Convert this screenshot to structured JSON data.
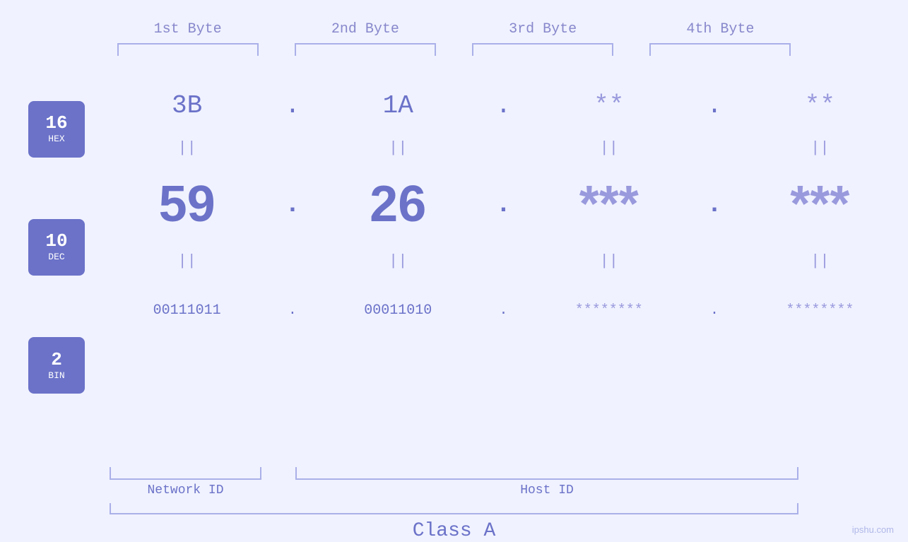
{
  "page": {
    "background": "#f0f2ff",
    "watermark": "ipshu.com"
  },
  "headers": {
    "byte1": "1st Byte",
    "byte2": "2nd Byte",
    "byte3": "3rd Byte",
    "byte4": "4th Byte"
  },
  "badges": {
    "hex": {
      "num": "16",
      "label": "HEX"
    },
    "dec": {
      "num": "10",
      "label": "DEC"
    },
    "bin": {
      "num": "2",
      "label": "BIN"
    }
  },
  "hex_row": {
    "b1": "3B",
    "d1": ".",
    "b2": "1A",
    "d2": ".",
    "b3": "**",
    "d3": ".",
    "b4": "**"
  },
  "dec_row": {
    "b1": "59",
    "d1": ".",
    "b2": "26",
    "d2": ".",
    "b3": "***",
    "d3": ".",
    "b4": "***"
  },
  "bin_row": {
    "b1": "00111011",
    "d1": ".",
    "b2": "00011010",
    "d2": ".",
    "b3": "********",
    "d3": ".",
    "b4": "********"
  },
  "labels": {
    "network_id": "Network ID",
    "host_id": "Host ID",
    "class": "Class A"
  }
}
